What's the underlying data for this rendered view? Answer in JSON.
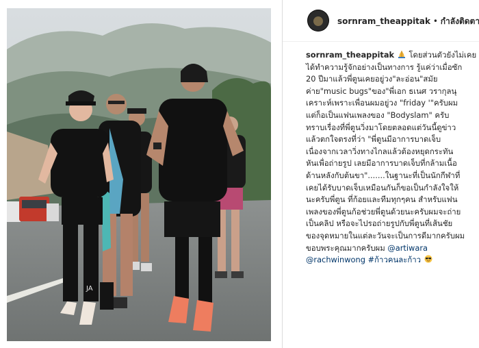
{
  "post": {
    "username": "sornram_theappitak",
    "separator": "•",
    "follow_label": "กำลังติดตาม"
  },
  "photo": {
    "shirt_text": "JA"
  },
  "caption": {
    "author": "sornram_theappitak",
    "lines": [
      "โดยส่วนตัวยังไม่เคย",
      "ได้ทำความรู้จักอย่างเป็นทางการ รู้แค่ว่าเมื่อซัก",
      "20 ปีมาแล้วพี่ตูนเคยอยู่วง\"ละอ่อน\"สมัย",
      "ค่าย\"music bugs\"ของ\"พี่เอก ธเนศ วรากุลนุ",
      "เคราะห์เพราะเพื่อนผมอยู่วง \"friday '\"ครับผม",
      "แต่ก็อเป็นแฟนเพลงของ \"Bodyslam\" ครับ",
      "ทราบเรื่องที่พี่ตูนวิ่งมาโดยตลอดแต่วันนี้ดูข่าว",
      "แล้วตกใจตรงที่ว่า \"พี่ตูนมีอาการบาดเจ็บ",
      "เนื่องจากเวลาวิ่งทางไกลแล้วต้องหยุดกระทัน",
      "หันเพื่อถ่ายรูป เลยมีอาการบาดเจ็บที่กล้ามเนื้อ",
      "ด้านหลังกับต้นขา\".......ในฐานะที่เป็นนักกีฬาที่",
      "เคยได้รับบาดเจ็บเหมือนกันก็ขอเป็นกำลังใจให้",
      "นะครับพี่ตูน ที่ก้อยและทีมทุกๆคน สำหรับแฟน",
      "เพลงของพี่ตูนก้อช่วยพี่ตูนด้วยนะครับผมจะถ่าย",
      "เป็นคลิป หรือจะไปรอถ่ายรูปกับพี่ตูนที่เส้นชัย",
      "ของจุดหมายในแต่ละวันจะเป็นการดีมากครับผม",
      "ขอบพระคุณมากครับผม"
    ],
    "mention_1": "@artiwara",
    "mention_2": "@rachwinwong",
    "hashtag": "#ก้าวคนละก้าว"
  },
  "icons": {
    "prayer": "folded-hands-emoji",
    "sunglasses": "sunglasses-emoji"
  }
}
